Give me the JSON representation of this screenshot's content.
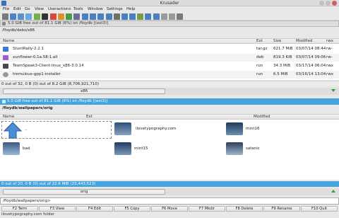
{
  "window": {
    "title": "Krusader"
  },
  "menu": [
    "File",
    "Edit",
    "Go",
    "View",
    "Useractions",
    "Tools",
    "Window",
    "Settings",
    "Help"
  ],
  "toolbar_icons": [
    "back-icon",
    "up-icon",
    "home-icon",
    "reload-icon",
    "refresh-icon",
    "terminal-icon",
    "delete-icon",
    "cut-icon",
    "copy-icon",
    "paste-icon",
    "newfolder-icon",
    "properties-icon",
    "sync-icon",
    "compare-icon",
    "find-icon",
    "mount-icon",
    "zoom-in-icon",
    "zoom-out-icon",
    "search-icon",
    "fit-icon"
  ],
  "top_panel": {
    "free_space": "5.0 GiB free out of 81.1 GiB (6%) on /floydb [(ext3)]",
    "path": "/floydb/debs/x86",
    "columns": {
      "name": "Name",
      "ext": "Ext",
      "size": "Size",
      "modified": "Modified",
      "perms": "rwx"
    },
    "rows": [
      {
        "name": "StuntRally-2.2.1",
        "ext": "tar.gz",
        "size": "621.7 MiB",
        "modified": "03/07/14 08:44",
        "perms": "rw-",
        "color": "#3b7bd1"
      },
      {
        "name": "xunflower-0.1a.58-1.all",
        "ext": "deb",
        "size": "819.3 KiB",
        "modified": "03/07/14 09:06",
        "perms": "rw-",
        "color": "#a25ac7"
      },
      {
        "name": "TeamSpeak3-Client-linux_x86-3.0.14",
        "ext": "run",
        "size": "34.3 MiB",
        "modified": "03/17/14 06:04",
        "perms": "rwx",
        "color": "#4a4a4a"
      },
      {
        "name": "tremulous-gpp1-installer",
        "ext": "run",
        "size": "6.5 MiB",
        "modified": "03/16/14 13:04",
        "perms": "rwx",
        "color": "#999999"
      }
    ],
    "status": "0 out of 32, 0 B (0) out of 8.2 GiB (8,706,921,710)",
    "tab": "x86"
  },
  "bottom_panel": {
    "free_space": "5.0 GiB free out of 81.1 GiB (6%) on /floydb [(ext3)]",
    "path": "/floydb/wallpapers/orig",
    "columns": {
      "name": "Name",
      "ext": "Ext",
      "modified": "Modified"
    },
    "items": [
      {
        "name": "..",
        "kind": "up"
      },
      {
        "name": "ilovetypography.com",
        "kind": "folder"
      },
      {
        "name": "mint16",
        "kind": "folder"
      },
      {
        "name": "bad",
        "kind": "folder"
      },
      {
        "name": "mint15",
        "kind": "folder"
      },
      {
        "name": "satanic",
        "kind": "folder"
      }
    ],
    "status": "0 out of 20, 0 B (0) out of 22.6 MiB (23,443,523)",
    "tab": "orig"
  },
  "command_line": "/floydb/wallpapers/orig>",
  "function_keys": [
    "F2 Term",
    "F3 View",
    "F4 Edit",
    "F5 Copy",
    "F6 Move",
    "F7 Mkdir",
    "F8 Delete",
    "F9 Rename",
    "F10 Quit"
  ],
  "bottom_status": "ilovetypography.com  folder"
}
